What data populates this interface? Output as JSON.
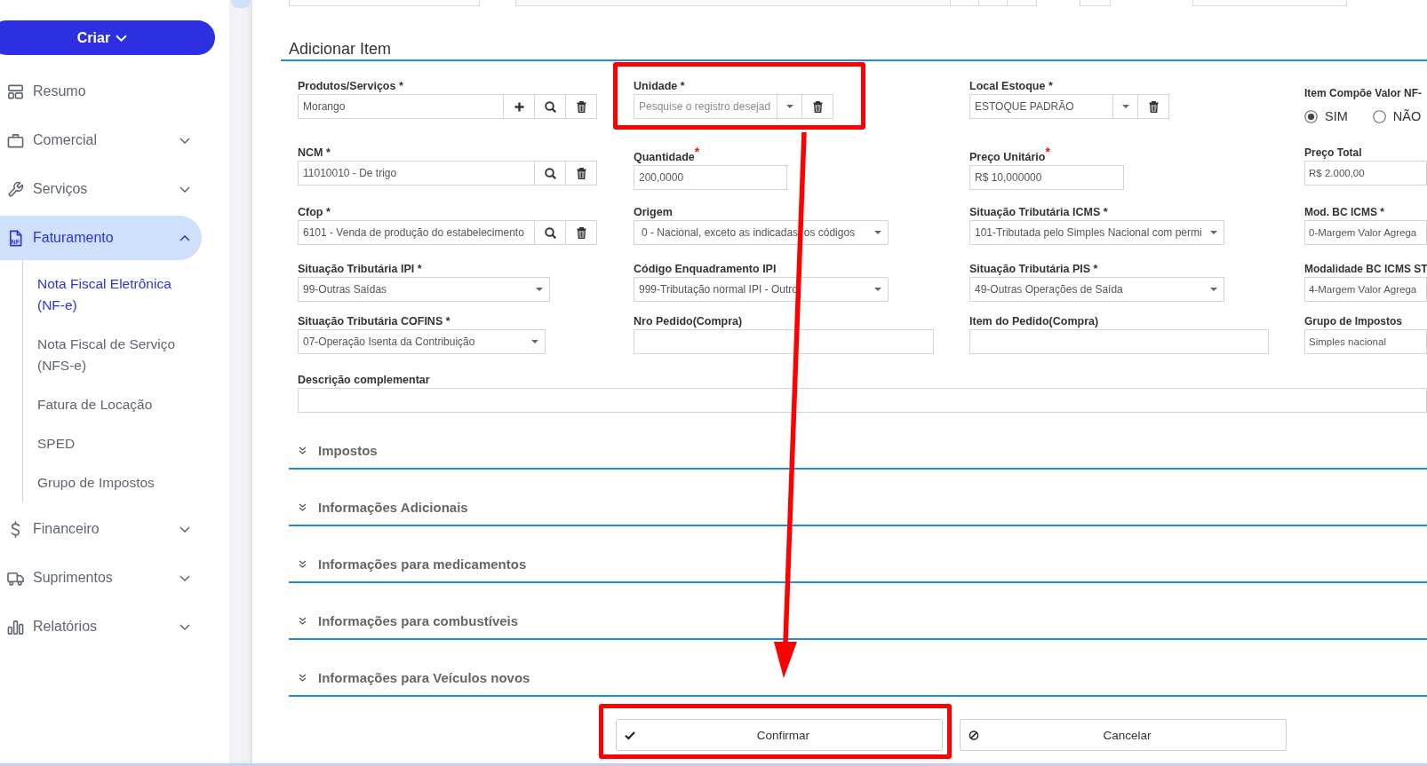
{
  "sidebar": {
    "create_button": {
      "label": "Criar"
    },
    "items": [
      {
        "kind": "link",
        "label": "Resumo",
        "selected": false
      },
      {
        "kind": "group",
        "label": "Comercial",
        "selected": false,
        "expanded": false
      },
      {
        "kind": "group",
        "label": "Serviços",
        "selected": false,
        "expanded": false
      },
      {
        "kind": "group",
        "label": "Faturamento",
        "selected": true,
        "expanded": true,
        "icon_text": "NF",
        "children": [
          {
            "label": "Nota Fiscal Eletrônica (NF-e)",
            "selected": true
          },
          {
            "label": "Nota Fiscal de Serviço (NFS-e)",
            "selected": false
          },
          {
            "label": "Fatura de Locação",
            "selected": false
          },
          {
            "label": "SPED",
            "selected": false
          },
          {
            "label": "Grupo de Impostos",
            "selected": false
          }
        ]
      },
      {
        "kind": "group",
        "label": "Financeiro",
        "selected": false,
        "expanded": false
      },
      {
        "kind": "group",
        "label": "Suprimentos",
        "selected": false,
        "expanded": false
      },
      {
        "kind": "group",
        "label": "Relatórios",
        "selected": false,
        "expanded": false
      }
    ]
  },
  "form": {
    "title": "Adicionar Item",
    "rows": [
      [
        {
          "kind": "lookup",
          "label": "Produtos/Serviços *",
          "value": "Morango",
          "buttons": [
            {
              "kind": "add"
            },
            {
              "kind": "search"
            },
            {
              "kind": "delete"
            }
          ],
          "highlighted": false
        },
        {
          "kind": "lookup",
          "label": "Unidade *",
          "placeholder": "Pesquise o registro desejad",
          "buttons": [
            {
              "kind": "dropdown"
            },
            {
              "kind": "delete"
            }
          ],
          "highlighted": true
        },
        {
          "kind": "lookup",
          "label": "Local Estoque *",
          "value": "ESTOQUE PADRÃO",
          "buttons": [
            {
              "kind": "dropdown"
            },
            {
              "kind": "delete"
            }
          ],
          "highlighted": false
        },
        {
          "kind": "radio",
          "label": "Item Compõe Valor NF-",
          "options": [
            {
              "label": "SIM",
              "selected": true
            },
            {
              "label": "NÃO",
              "selected": false
            }
          ],
          "highlighted": false
        }
      ],
      [
        {
          "kind": "lookup",
          "label": "NCM *",
          "value": "11010010 - De trigo",
          "buttons": [
            {
              "kind": "search"
            },
            {
              "kind": "delete"
            }
          ],
          "highlighted": false
        },
        {
          "kind": "text",
          "label": "Quantidade",
          "required_mark": "*",
          "value": "200,0000",
          "highlighted": false
        },
        {
          "kind": "text",
          "label": "Preço Unitário",
          "required_mark": "*",
          "value": "R$ 10,000000",
          "highlighted": false
        },
        {
          "kind": "text",
          "label": "Preço Total",
          "value": "R$ 2.000,00",
          "highlighted": false
        }
      ],
      [
        {
          "kind": "lookup",
          "label": "Cfop *",
          "value": "6101 - Venda de produção do estabelecimento",
          "buttons": [
            {
              "kind": "search"
            },
            {
              "kind": "delete"
            }
          ],
          "highlighted": false
        },
        {
          "kind": "select",
          "label": "Origem",
          "value": "0 - Nacional, exceto as indicadas  os códigos",
          "highlighted": false
        },
        {
          "kind": "select",
          "label": "Situação Tributária ICMS *",
          "value": "101-Tributada pelo Simples Nacional com permi",
          "highlighted": false
        },
        {
          "kind": "text",
          "label": "Mod. BC ICMS *",
          "value": "0-Margem Valor Agrega",
          "highlighted": false
        }
      ],
      [
        {
          "kind": "select",
          "label": "Situação Tributária IPI *",
          "value": "99-Outras Saídas",
          "highlighted": false
        },
        {
          "kind": "select",
          "label": "Código Enquadramento IPI",
          "value": "999-Tributação normal IPI - Outro",
          "highlighted": false
        },
        {
          "kind": "select",
          "label": "Situação Tributária PIS *",
          "value": "49-Outras Operações de Saída",
          "highlighted": false
        },
        {
          "kind": "text",
          "label": "Modalidade BC ICMS ST",
          "value": "4-Margem Valor Agrega",
          "highlighted": false
        }
      ],
      [
        {
          "kind": "select",
          "label": "Situação Tributária COFINS *",
          "value": "07-Operação Isenta da Contribuição",
          "highlighted": false
        },
        {
          "kind": "text",
          "label": "Nro Pedido(Compra)",
          "highlighted": false
        },
        {
          "kind": "text",
          "label": "Item do Pedido(Compra)",
          "highlighted": false
        },
        {
          "kind": "text",
          "label": "Grupo de Impostos",
          "value": "Simples nacional",
          "highlighted": false
        }
      ],
      [
        {
          "kind": "text",
          "label": "Descrição complementar",
          "highlighted": false
        }
      ]
    ]
  },
  "sections": [
    {
      "title": "Impostos",
      "expanded": false
    },
    {
      "title": "Informações Adicionais",
      "expanded": false
    },
    {
      "title": "Informações para medicamentos",
      "expanded": false
    },
    {
      "title": "Informações para combustíveis",
      "expanded": false
    },
    {
      "title": "Informações para Veículos novos",
      "expanded": false
    }
  ],
  "actions": [
    {
      "kind": "confirm",
      "label": "Confirmar",
      "highlighted": true
    },
    {
      "kind": "cancel",
      "label": "Cancelar",
      "highlighted": false
    }
  ],
  "annotation": {
    "arrow": true
  }
}
